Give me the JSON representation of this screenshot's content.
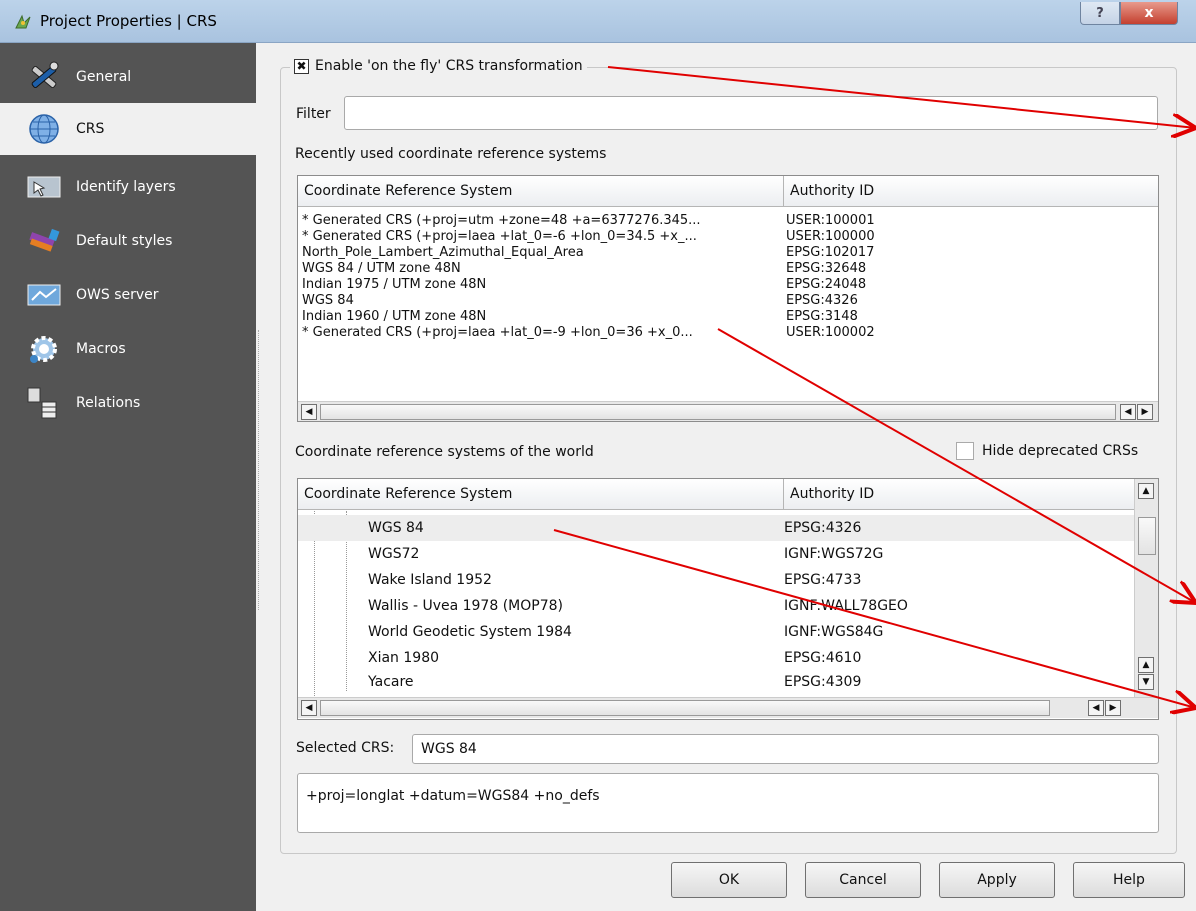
{
  "window": {
    "title": "Project Properties | CRS",
    "help_glyph": "?",
    "close_glyph": "x"
  },
  "sidebar": {
    "items": [
      {
        "label": "General",
        "icon": "tools-icon"
      },
      {
        "label": "CRS",
        "icon": "globe-icon"
      },
      {
        "label": "Identify layers",
        "icon": "identify-icon"
      },
      {
        "label": "Default styles",
        "icon": "brush-icon"
      },
      {
        "label": "OWS server",
        "icon": "ows-icon"
      },
      {
        "label": "Macros",
        "icon": "macros-icon"
      },
      {
        "label": "Relations",
        "icon": "relations-icon"
      }
    ]
  },
  "crs": {
    "enable_label": "Enable 'on the fly' CRS transformation",
    "enable_checked": true,
    "check_glyph": "✖",
    "filter_label": "Filter",
    "filter_value": "",
    "recent_label": "Recently used coordinate reference systems",
    "col_crs": "Coordinate Reference System",
    "col_auth": "Authority ID",
    "recent_rows": [
      {
        "name": " * Generated CRS (+proj=utm +zone=48 +a=6377276.345...",
        "id": "USER:100001"
      },
      {
        "name": " * Generated CRS (+proj=laea +lat_0=-6 +lon_0=34.5 +x_...",
        "id": "USER:100000"
      },
      {
        "name": "North_Pole_Lambert_Azimuthal_Equal_Area",
        "id": "EPSG:102017"
      },
      {
        "name": "WGS 84 / UTM zone 48N",
        "id": "EPSG:32648"
      },
      {
        "name": "Indian 1975 / UTM zone 48N",
        "id": "EPSG:24048"
      },
      {
        "name": "WGS 84",
        "id": "EPSG:4326"
      },
      {
        "name": "Indian 1960 / UTM zone 48N",
        "id": "EPSG:3148"
      },
      {
        "name": " * Generated CRS (+proj=laea +lat_0=-9 +lon_0=36 +x_0...",
        "id": "USER:100002"
      }
    ],
    "world_label": "Coordinate reference systems of the world",
    "hide_deprecated_label": "Hide deprecated CRSs",
    "hide_deprecated_checked": false,
    "world_rows": [
      {
        "name": "WGS 84",
        "id": "EPSG:4326"
      },
      {
        "name": "WGS72",
        "id": "IGNF:WGS72G"
      },
      {
        "name": "Wake Island 1952",
        "id": "EPSG:4733"
      },
      {
        "name": "Wallis - Uvea 1978 (MOP78)",
        "id": "IGNF:WALL78GEO"
      },
      {
        "name": "World Geodetic System 1984",
        "id": "IGNF:WGS84G"
      },
      {
        "name": "Xian 1980",
        "id": "EPSG:4610"
      },
      {
        "name": "Yacare",
        "id": "EPSG:4309"
      }
    ],
    "selected_label": "Selected CRS:",
    "selected_value": "WGS 84",
    "proj_string": "+proj=longlat +datum=WGS84 +no_defs"
  },
  "buttons": {
    "ok": "OK",
    "cancel": "Cancel",
    "apply": "Apply",
    "help": "Help"
  },
  "colors": {
    "sidebar_bg": "#545454",
    "annotation_arrow": "#e00000",
    "title_bg": "#b5cde6"
  }
}
